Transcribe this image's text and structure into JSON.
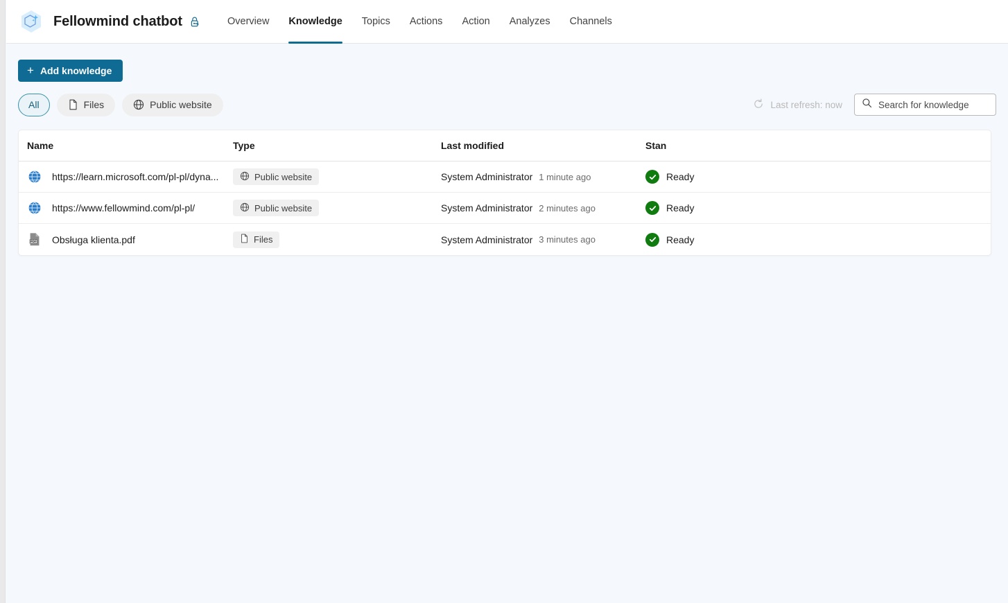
{
  "header": {
    "logo_icon": "sparkle-hexagon-icon",
    "app_title": "Fellowmind chatbot",
    "title_badge_icon": "lock-key-icon",
    "nav": [
      {
        "label": "Overview",
        "active": false
      },
      {
        "label": "Knowledge",
        "active": true
      },
      {
        "label": "Topics",
        "active": false
      },
      {
        "label": "Actions",
        "active": false
      },
      {
        "label": "Action",
        "active": false
      },
      {
        "label": "Analyzes",
        "active": false
      },
      {
        "label": "Channels",
        "active": false
      }
    ]
  },
  "toolbar": {
    "add_knowledge_label": "Add knowledge",
    "add_icon": "plus-icon",
    "filters": [
      {
        "label": "All",
        "icon": null,
        "selected": true
      },
      {
        "label": "Files",
        "icon": "document-icon",
        "selected": false
      },
      {
        "label": "Public website",
        "icon": "globe-icon",
        "selected": false
      }
    ],
    "refresh": {
      "icon": "refresh-icon",
      "label": "Last refresh: now"
    },
    "search": {
      "icon": "search-icon",
      "placeholder": "Search for knowledge",
      "value": ""
    }
  },
  "table": {
    "columns": [
      "Name",
      "Type",
      "Last modified",
      "Stan"
    ],
    "rows": [
      {
        "icon": "globe-icon",
        "name": "https://learn.microsoft.com/pl-pl/dyna...",
        "type_label": "Public website",
        "type_icon": "globe-icon",
        "modified_by": "System Administrator",
        "modified_when": "1 minute ago",
        "status_icon": "checkmark-circle-icon",
        "status": "Ready"
      },
      {
        "icon": "globe-icon",
        "name": "https://www.fellowmind.com/pl-pl/",
        "type_label": "Public website",
        "type_icon": "globe-icon",
        "modified_by": "System Administrator",
        "modified_when": "2 minutes ago",
        "status_icon": "checkmark-circle-icon",
        "status": "Ready"
      },
      {
        "icon": "pdf-file-icon",
        "name": "Obsługa klienta.pdf",
        "type_label": "Files",
        "type_icon": "document-icon",
        "modified_by": "System Administrator",
        "modified_when": "3 minutes ago",
        "status_icon": "checkmark-circle-icon",
        "status": "Ready"
      }
    ]
  },
  "colors": {
    "accent": "#0f6b93",
    "active_tab_underline": "#0f6b8f",
    "selected_pill_border": "#3a91ad",
    "status_green": "#107c10",
    "page_background": "#f5f8fc"
  }
}
